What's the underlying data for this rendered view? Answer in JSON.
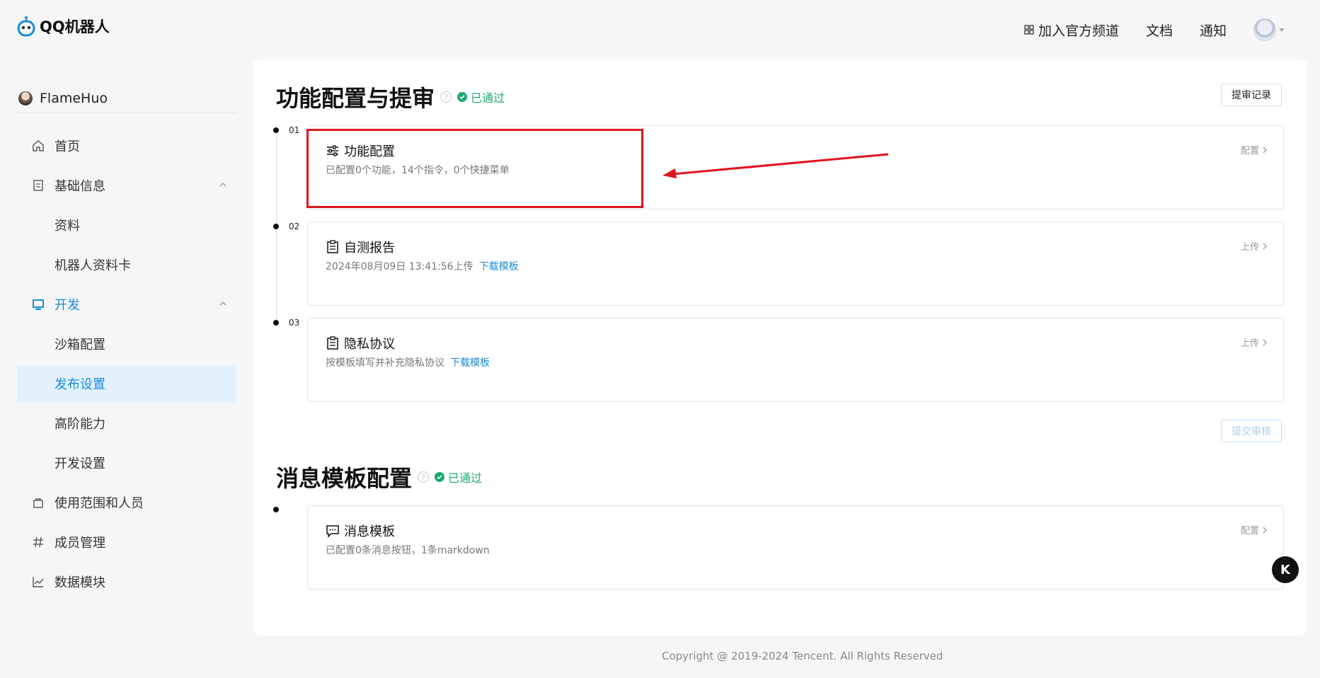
{
  "app": {
    "logo_text": "QQ机器人"
  },
  "topnav": {
    "channel": "加入官方频道",
    "docs": "文档",
    "notice": "通知"
  },
  "sidebar": {
    "username": "FlameHuo",
    "items": [
      {
        "label": "首页"
      },
      {
        "label": "基础信息"
      },
      {
        "label": "资料"
      },
      {
        "label": "机器人资料卡"
      },
      {
        "label": "开发"
      },
      {
        "label": "沙箱配置"
      },
      {
        "label": "发布设置"
      },
      {
        "label": "高阶能力"
      },
      {
        "label": "开发设置"
      },
      {
        "label": "使用范围和人员"
      },
      {
        "label": "成员管理"
      },
      {
        "label": "数据模块"
      }
    ]
  },
  "section1": {
    "title": "功能配置与提审",
    "status": "已通过",
    "history_button": "提审记录",
    "submit_button": "提交审核",
    "steps": [
      {
        "no": "01",
        "title": "功能配置",
        "desc": "已配置0个功能，14个指令，0个快捷菜单",
        "link": "",
        "action": "配置"
      },
      {
        "no": "02",
        "title": "自测报告",
        "desc": "2024年08月09日 13:41:56上传",
        "link": "下载模板",
        "action": "上传"
      },
      {
        "no": "03",
        "title": "隐私协议",
        "desc": "按模板填写并补充隐私协议",
        "link": "下载模板",
        "action": "上传"
      }
    ]
  },
  "section2": {
    "title": "消息模板配置",
    "status": "已通过",
    "card": {
      "title": "消息模板",
      "desc": "已配置0条消息按钮，1条markdown",
      "action": "配置"
    }
  },
  "footer": {
    "copyright": "Copyright @ 2019-2024 Tencent. All Rights Reserved"
  },
  "float_button": {
    "label": "K"
  },
  "colors": {
    "accent": "#1d8bd8",
    "success": "#1aab6d",
    "highlight": "#e0141c"
  }
}
